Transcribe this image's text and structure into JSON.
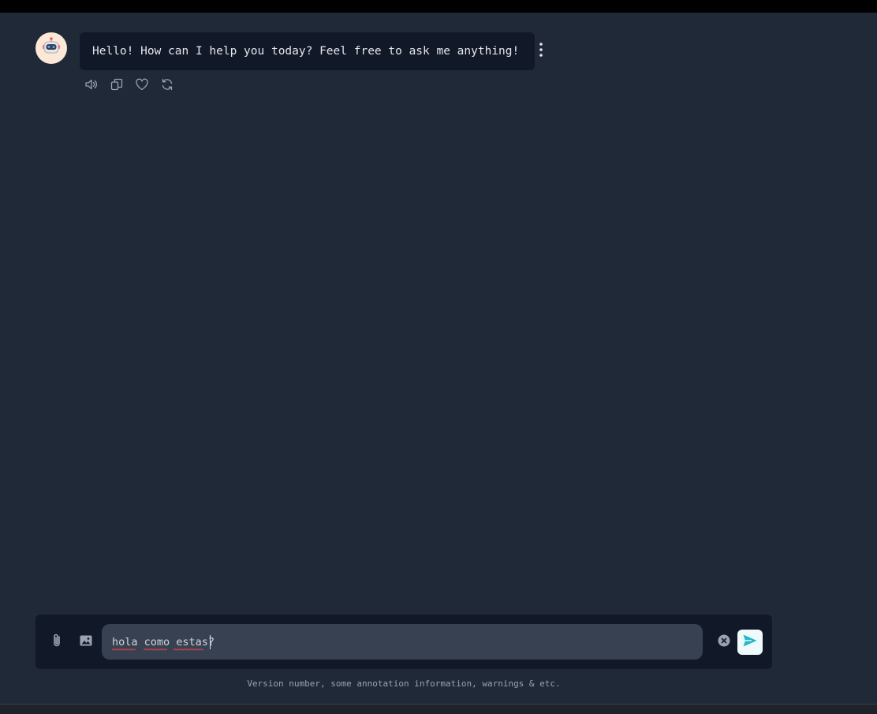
{
  "chat": {
    "messages": [
      {
        "role": "assistant",
        "text": "Hello! How can I help you today? Feel free to ask me anything!",
        "avatar_icon": "robot-icon",
        "actions": [
          "speaker-icon",
          "copy-icon",
          "heart-icon",
          "refresh-icon"
        ]
      }
    ]
  },
  "composer": {
    "input_value": "hola como estas?",
    "buttons": [
      "paperclip-icon",
      "image-icon",
      "clear-icon",
      "send-icon"
    ]
  },
  "footer": {
    "note": "Version number, some annotation information, warnings & etc."
  },
  "colors": {
    "background": "#1f2937",
    "bubble": "#111827",
    "input": "#374151",
    "accent": "#22b8c8",
    "avatar_bg": "#fde7d6"
  }
}
